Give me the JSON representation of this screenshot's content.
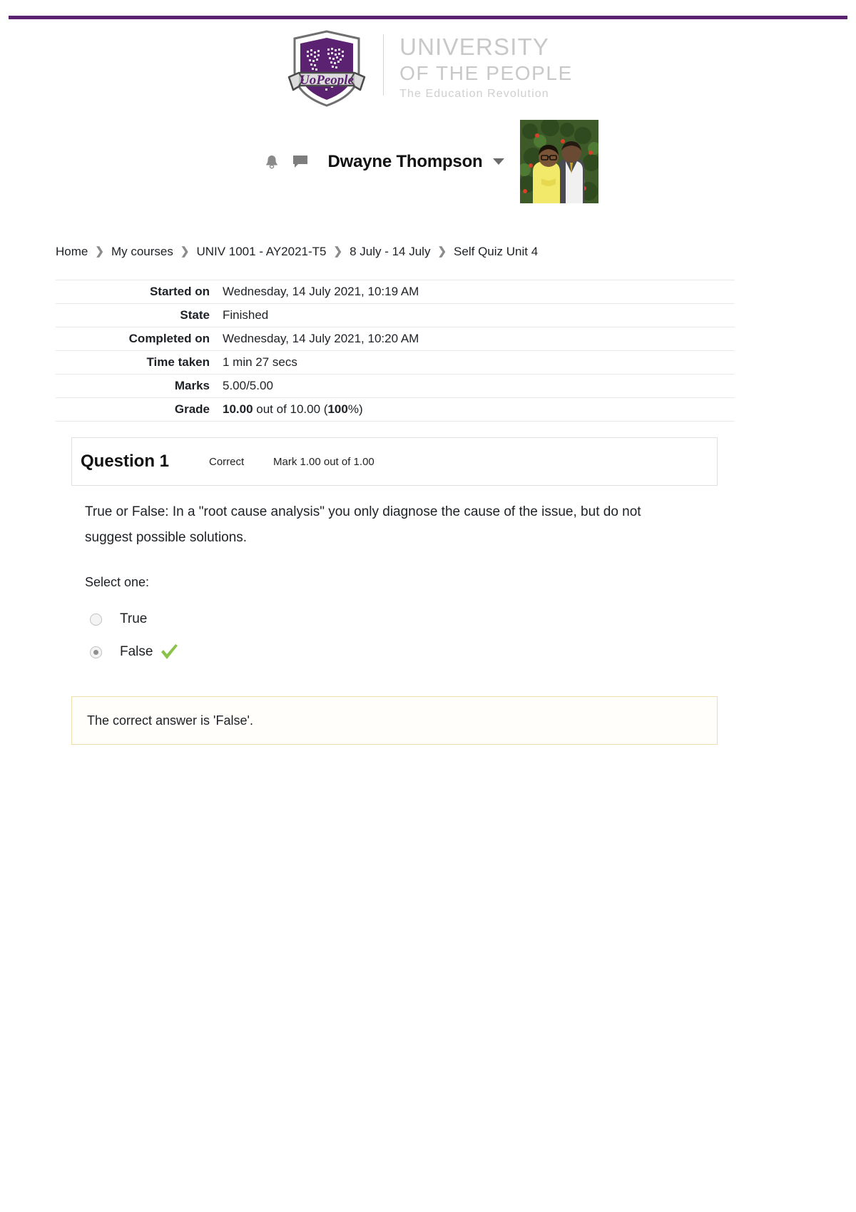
{
  "theme": {
    "topbar_color": "#5b2271",
    "wordmark_color": "#c8c8c8",
    "tick_color": "#8bc34a",
    "feedback_border": "#f0dfae"
  },
  "logo": {
    "banner_text": "UoPeople",
    "line1": "UNIVERSITY",
    "line2": "OF THE PEOPLE",
    "line3": "The Education Revolution"
  },
  "usernav": {
    "notification_icon": "bell-icon",
    "messages_icon": "message-icon",
    "user_name": "Dwayne Thompson",
    "caret_icon": "chevron-down-icon",
    "avatar_alt": "user-avatar-photo"
  },
  "breadcrumb": {
    "separator": "❯",
    "items": [
      {
        "label": "Home"
      },
      {
        "label": "My courses"
      },
      {
        "label": "UNIV 1001 - AY2021-T5"
      },
      {
        "label": "8 July - 14 July"
      },
      {
        "label": "Self Quiz Unit 4"
      }
    ]
  },
  "attempt_info": {
    "rows": [
      {
        "label": "Started on",
        "value": "Wednesday, 14 July 2021, 10:19 AM"
      },
      {
        "label": "State",
        "value": "Finished"
      },
      {
        "label": "Completed on",
        "value": "Wednesday, 14 July 2021, 10:20 AM"
      },
      {
        "label": "Time taken",
        "value": "1 min 27 secs"
      },
      {
        "label": "Marks",
        "value": "5.00/5.00"
      }
    ],
    "grade": {
      "label": "Grade",
      "value_bold": "10.00",
      "value_mid": " out of 10.00 (",
      "percent_bold": "100",
      "value_end": "%)"
    }
  },
  "question": {
    "number_label": "Question 1",
    "state": "Correct",
    "mark": "Mark 1.00 out of 1.00",
    "text": "True or False: In a \"root cause analysis\" you only diagnose the cause of the issue, but do not suggest possible solutions.",
    "select_prompt": "Select one:",
    "options": [
      {
        "label": "True",
        "selected": false,
        "correct_tick": false
      },
      {
        "label": "False",
        "selected": true,
        "correct_tick": true
      }
    ],
    "feedback": "The correct answer is 'False'."
  }
}
